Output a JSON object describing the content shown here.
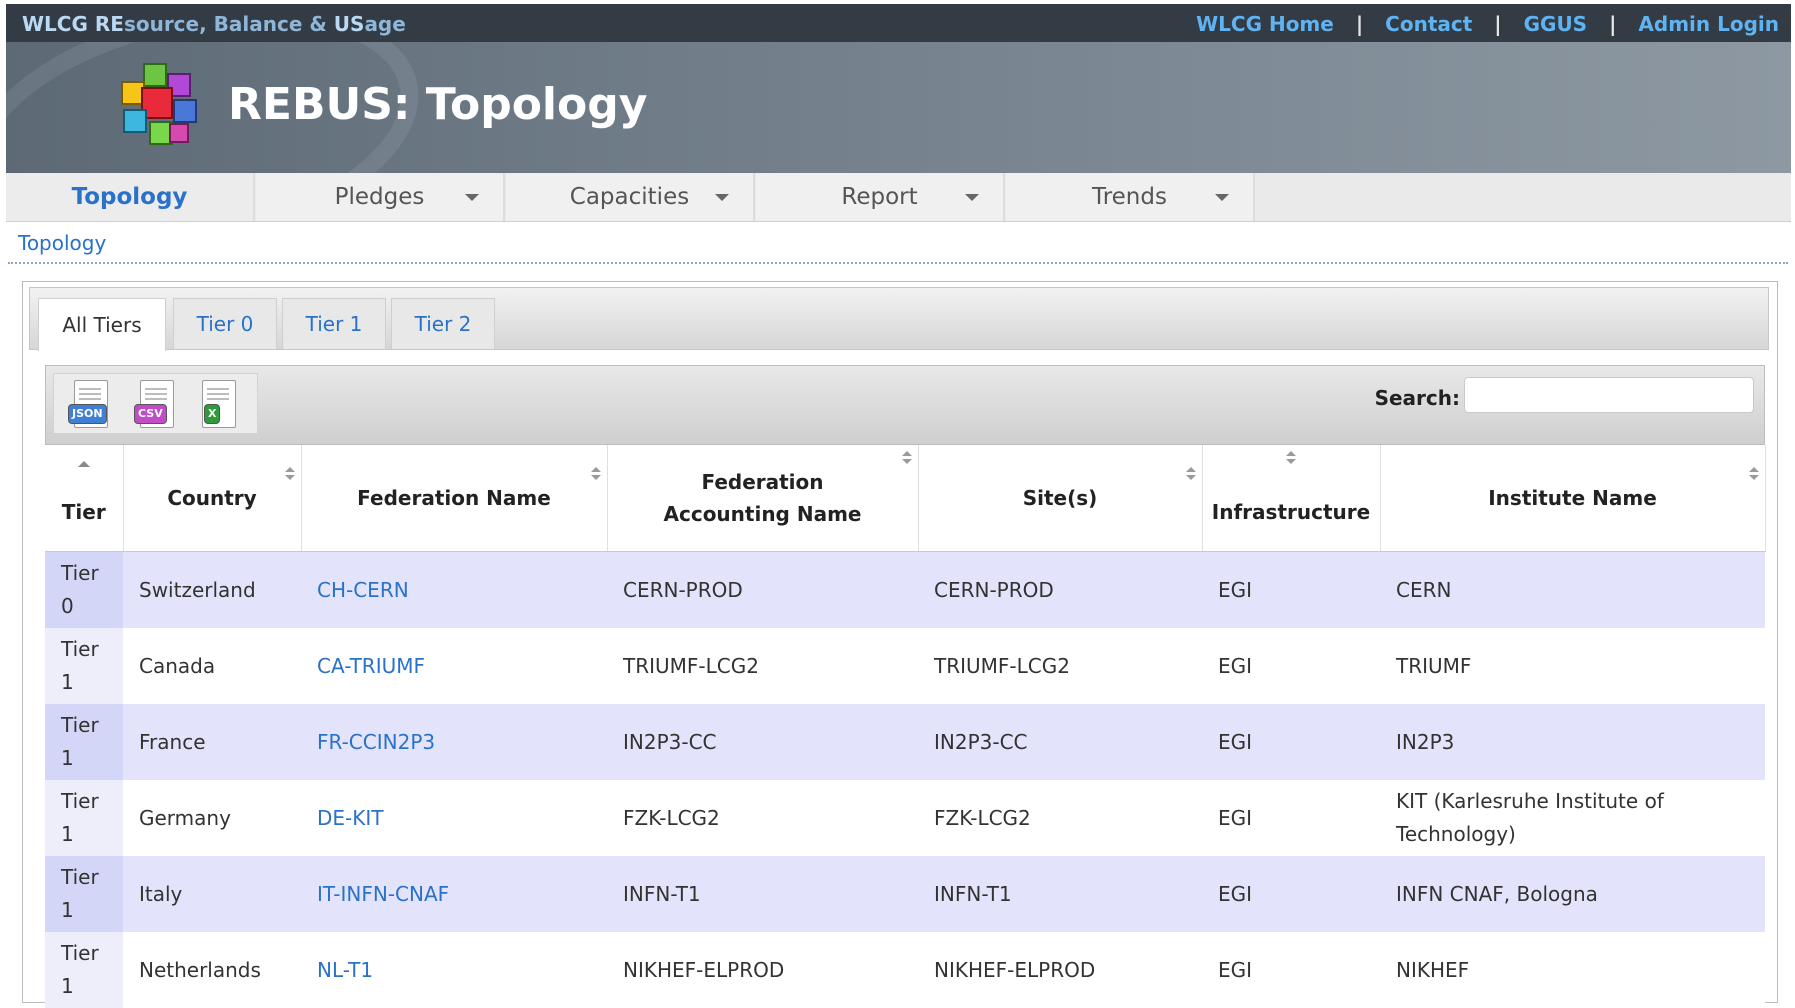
{
  "header": {
    "site_title_parts": [
      "WLCG RE",
      "source, Balance & ",
      "US",
      "age"
    ],
    "links": [
      "WLCG Home",
      "Contact",
      "GGUS",
      "Admin Login"
    ],
    "separator": "|"
  },
  "banner": {
    "title": "REBUS: Topology"
  },
  "nav": {
    "tabs": [
      {
        "label": "Topology",
        "active": true,
        "dropdown": false
      },
      {
        "label": "Pledges",
        "active": false,
        "dropdown": true
      },
      {
        "label": "Capacities",
        "active": false,
        "dropdown": true
      },
      {
        "label": "Report",
        "active": false,
        "dropdown": true
      },
      {
        "label": "Trends",
        "active": false,
        "dropdown": true
      }
    ]
  },
  "breadcrumb": "Topology",
  "tier_tabs": [
    {
      "label": "All Tiers",
      "active": true
    },
    {
      "label": "Tier 0",
      "active": false
    },
    {
      "label": "Tier 1",
      "active": false
    },
    {
      "label": "Tier 2",
      "active": false
    }
  ],
  "toolbar": {
    "export_icons": [
      {
        "name": "json-export-icon",
        "tag": "JSON",
        "color": "#3f7fd6"
      },
      {
        "name": "csv-export-icon",
        "tag": "CSV",
        "color": "#c04cc7"
      },
      {
        "name": "excel-export-icon",
        "tag": "X",
        "color": "#2e9b3a"
      }
    ],
    "search_label": "Search:",
    "search_value": ""
  },
  "table": {
    "columns": [
      "Tier",
      "Country",
      "Federation Name",
      "Federation Accounting Name",
      "Site(s)",
      "Infrastructure",
      "Institute Name"
    ],
    "rows": [
      [
        "Tier 0",
        "Switzerland",
        "CH-CERN",
        "CERN-PROD",
        "CERN-PROD",
        "EGI",
        "CERN"
      ],
      [
        "Tier 1",
        "Canada",
        "CA-TRIUMF",
        "TRIUMF-LCG2",
        "TRIUMF-LCG2",
        "EGI",
        "TRIUMF"
      ],
      [
        "Tier 1",
        "France",
        "FR-CCIN2P3",
        "IN2P3-CC",
        "IN2P3-CC",
        "EGI",
        "IN2P3"
      ],
      [
        "Tier 1",
        "Germany",
        "DE-KIT",
        "FZK-LCG2",
        "FZK-LCG2",
        "EGI",
        "KIT (Karlesruhe Institute of Technology)"
      ],
      [
        "Tier 1",
        "Italy",
        "IT-INFN-CNAF",
        "INFN-T1",
        "INFN-T1",
        "EGI",
        "INFN CNAF, Bologna"
      ],
      [
        "Tier 1",
        "Netherlands",
        "NL-T1",
        "NIKHEF-ELPROD",
        "NIKHEF-ELPROD",
        "EGI",
        "NIKHEF"
      ]
    ]
  },
  "colors": {
    "link": "#2a72c9",
    "row_odd": "#e3e4fb",
    "row_even": "#ffffff",
    "topbar": "#333c44"
  }
}
